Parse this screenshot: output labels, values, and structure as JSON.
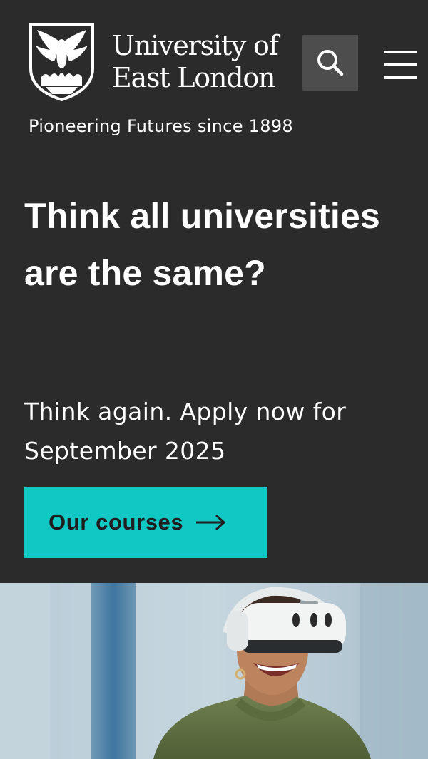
{
  "header": {
    "logo_icon": "phoenix-crest-icon",
    "wordmark_line1": "University of",
    "wordmark_line2": "East London",
    "search_icon": "search-icon",
    "menu_icon": "hamburger-menu-icon",
    "tagline": "Pioneering Futures since 1898"
  },
  "hero": {
    "headline": "Think all universities are the same?",
    "subheadline": "Think again. Apply now for September 2025",
    "cta_label": "Our courses",
    "cta_icon": "arrow-right-icon",
    "image_subject": "student-vr-headset-photo"
  },
  "colors": {
    "background": "#2b2b2b",
    "accent": "#12c8c4",
    "search_button": "#4d4d4d",
    "text": "#ffffff",
    "cta_text": "#1e1e1e"
  }
}
